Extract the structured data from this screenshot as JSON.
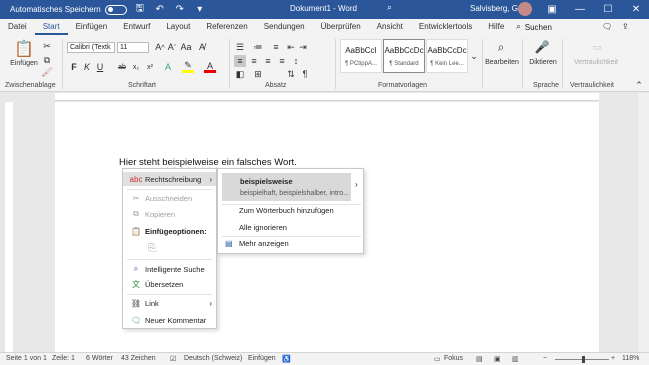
{
  "titlebar": {
    "autosave_label": "Automatisches Speichern",
    "autosave_state": "Aus",
    "document_title": "Dokument1 - Word",
    "search_label": "Suchen",
    "user_name": "Salvisberg, Gaby",
    "accent_color": "#2b579a"
  },
  "tabs": [
    {
      "label": "Datei"
    },
    {
      "label": "Start"
    },
    {
      "label": "Einfügen"
    },
    {
      "label": "Entwurf"
    },
    {
      "label": "Layout"
    },
    {
      "label": "Referenzen"
    },
    {
      "label": "Sendungen"
    },
    {
      "label": "Überprüfen"
    },
    {
      "label": "Ansicht"
    },
    {
      "label": "Entwicklertools"
    },
    {
      "label": "Hilfe"
    }
  ],
  "ribbon": {
    "paste_label": "Einfügen",
    "font_name": "Calibri (Textk",
    "font_size": "11",
    "styles": [
      {
        "sample": "AaBbCcI",
        "name": "¶ PCtippA..."
      },
      {
        "sample": "AaBbCcDc",
        "name": "¶ Standard"
      },
      {
        "sample": "AaBbCcDc",
        "name": "¶ Kein Lee..."
      }
    ],
    "edit_label": "Bearbeiten",
    "dictate_label": "Diktieren",
    "sensitivity_label": "Vertraulichkeit",
    "groups": {
      "clipboard": "Zwischenablage",
      "font": "Schriftart",
      "paragraph": "Absatz",
      "styles": "Formatvorlagen",
      "voice": "Sprache",
      "sensitivity": "Vertraulichkeit"
    }
  },
  "document": {
    "text_before": "Hier steht ",
    "misspelled": "beispielweise",
    "text_after": " ein falsches Wort."
  },
  "context_menu": {
    "spelling": "Rechtschreibung",
    "cut": "Ausschneiden",
    "copy": "Kopieren",
    "paste_options": "Einfügeoptionen:",
    "smart_lookup": "Intelligente Suche",
    "translate": "Übersetzen",
    "link": "Link",
    "new_comment": "Neuer Kommentar"
  },
  "spelling_submenu": {
    "suggestion": "beispielsweise",
    "synonyms": "beispielhaft, beispielshalber, intro...",
    "add_to_dictionary": "Zum Wörterbuch hinzufügen",
    "ignore_all": "Alle ignorieren",
    "show_more": "Mehr anzeigen"
  },
  "statusbar": {
    "page": "Seite 1 von 1",
    "line": "Zeile: 1",
    "words": "6 Wörter",
    "chars": "43 Zeichen",
    "language": "Deutsch (Schweiz)",
    "mode": "Einfügen",
    "focus": "Fokus",
    "zoom": "118%"
  }
}
